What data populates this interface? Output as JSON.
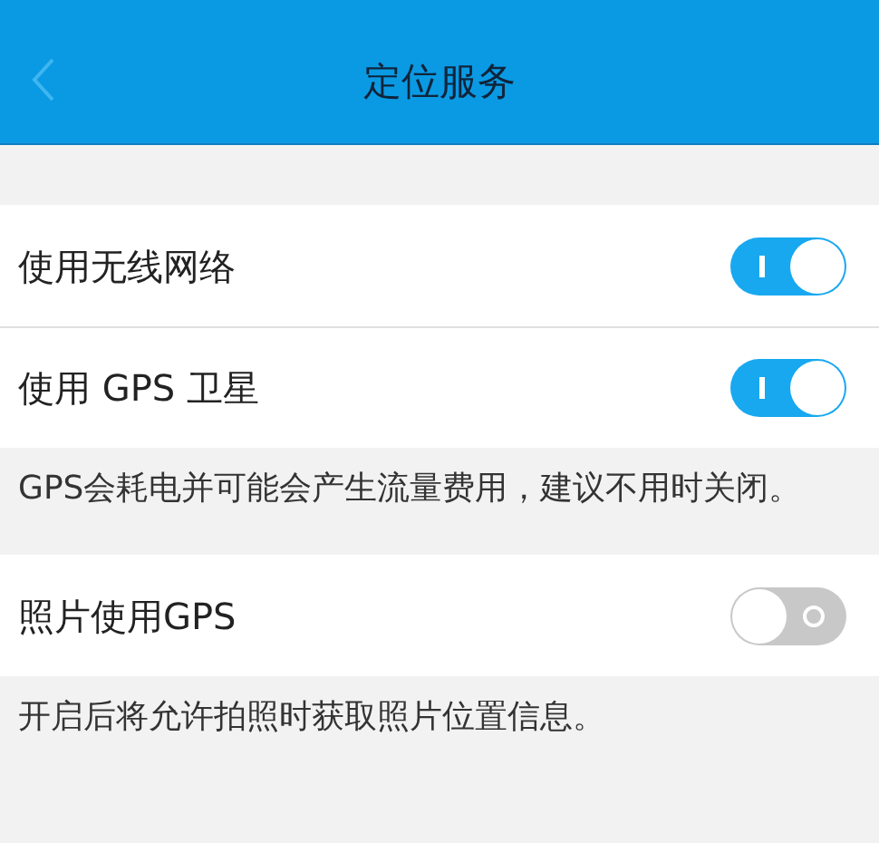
{
  "header": {
    "title": "定位服务"
  },
  "groups": [
    {
      "items": [
        {
          "label": "使用无线网络",
          "on": true
        },
        {
          "label": "使用 GPS 卫星",
          "on": true
        }
      ],
      "note": "GPS会耗电并可能会产生流量费用，建议不用时关闭。"
    },
    {
      "items": [
        {
          "label": "照片使用GPS",
          "on": false
        }
      ],
      "note": "开启后将允许拍照时获取照片位置信息。"
    }
  ]
}
